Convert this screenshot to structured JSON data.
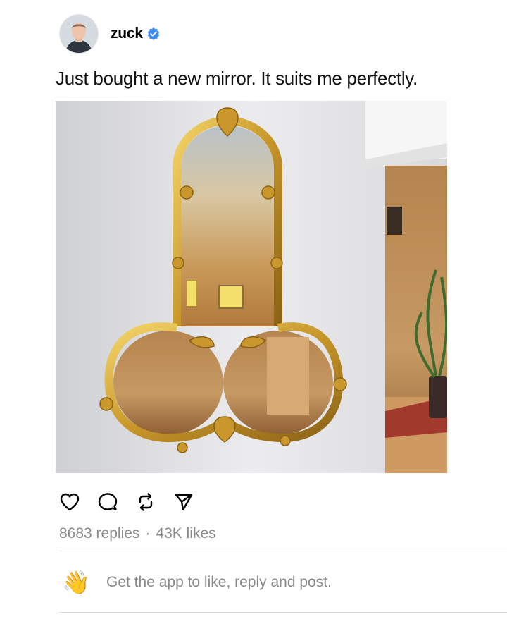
{
  "post": {
    "username": "zuck",
    "caption": "Just bought a new mirror. It suits me perfectly.",
    "replies": "8683 replies",
    "separator": "·",
    "likes": "43K likes"
  },
  "actions": [
    "heart-icon",
    "comment-icon",
    "repost-icon",
    "share-icon"
  ],
  "footer": {
    "cta_text": "Get the app to like, reply and post.",
    "emoji": "👋"
  },
  "colors": {
    "verified": "#3d8cf5",
    "muted_text": "#8a8a8a",
    "divider": "#d9d9d9"
  }
}
